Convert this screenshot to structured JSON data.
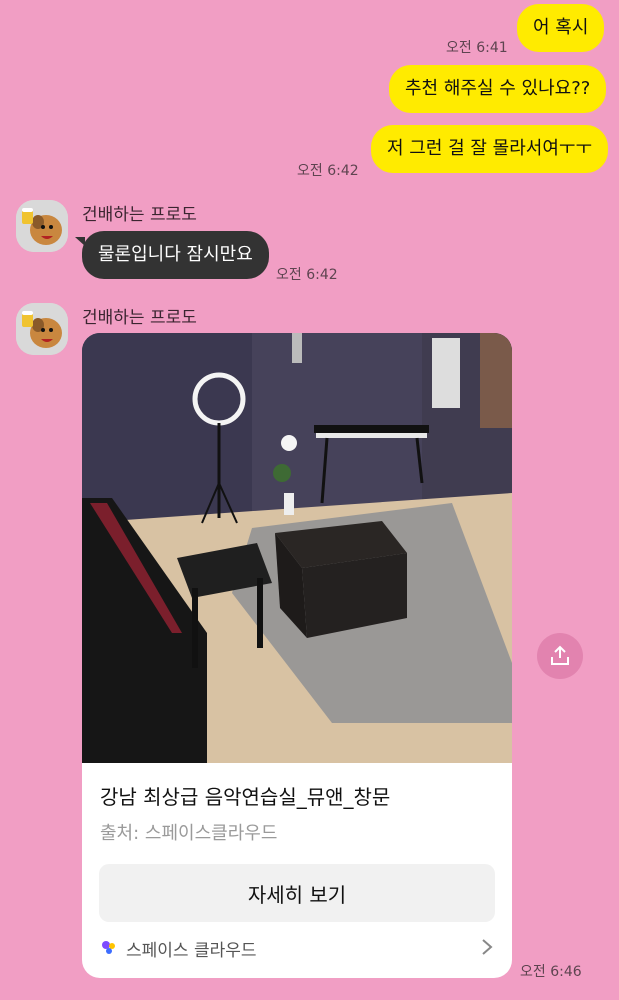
{
  "colors": {
    "background": "#F19EC4",
    "my_bubble": "#FFEB00",
    "other_bubble": "#333333"
  },
  "messages_me": [
    {
      "text": "어 혹시"
    },
    {
      "text": "추천 해주실 수 있나요??"
    },
    {
      "text": "저 그런 걸 잘 몰라서여ㅜㅜ"
    }
  ],
  "times": {
    "t1": "오전 6:41",
    "t2": "오전 6:42",
    "t3": "오전 6:42",
    "t4": "오전 6:46"
  },
  "other": {
    "name": "건배하는 프로도",
    "avatar_icon": "frodo-cheers-icon",
    "message": "물론입니다 잠시만요"
  },
  "card": {
    "title": "강남 최상급 음악연습실_뮤앤_창문",
    "source": "출처: 스페이스클라우드",
    "button_label": "자세히 보기",
    "footer_label": "스페이스 클라우드",
    "footer_icon": "spacecloud-logo-icon"
  },
  "share_icon": "share-icon"
}
